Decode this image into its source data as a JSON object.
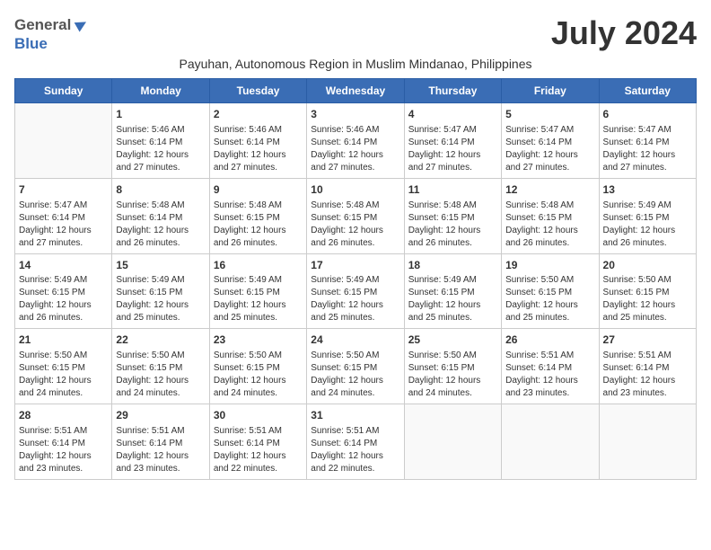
{
  "header": {
    "logo_general": "General",
    "logo_blue": "Blue",
    "month_title": "July 2024",
    "subtitle": "Payuhan, Autonomous Region in Muslim Mindanao, Philippines"
  },
  "days_of_week": [
    "Sunday",
    "Monday",
    "Tuesday",
    "Wednesday",
    "Thursday",
    "Friday",
    "Saturday"
  ],
  "weeks": [
    [
      {
        "day": "",
        "info": ""
      },
      {
        "day": "1",
        "info": "Sunrise: 5:46 AM\nSunset: 6:14 PM\nDaylight: 12 hours\nand 27 minutes."
      },
      {
        "day": "2",
        "info": "Sunrise: 5:46 AM\nSunset: 6:14 PM\nDaylight: 12 hours\nand 27 minutes."
      },
      {
        "day": "3",
        "info": "Sunrise: 5:46 AM\nSunset: 6:14 PM\nDaylight: 12 hours\nand 27 minutes."
      },
      {
        "day": "4",
        "info": "Sunrise: 5:47 AM\nSunset: 6:14 PM\nDaylight: 12 hours\nand 27 minutes."
      },
      {
        "day": "5",
        "info": "Sunrise: 5:47 AM\nSunset: 6:14 PM\nDaylight: 12 hours\nand 27 minutes."
      },
      {
        "day": "6",
        "info": "Sunrise: 5:47 AM\nSunset: 6:14 PM\nDaylight: 12 hours\nand 27 minutes."
      }
    ],
    [
      {
        "day": "7",
        "info": "Sunrise: 5:47 AM\nSunset: 6:14 PM\nDaylight: 12 hours\nand 27 minutes."
      },
      {
        "day": "8",
        "info": "Sunrise: 5:48 AM\nSunset: 6:14 PM\nDaylight: 12 hours\nand 26 minutes."
      },
      {
        "day": "9",
        "info": "Sunrise: 5:48 AM\nSunset: 6:15 PM\nDaylight: 12 hours\nand 26 minutes."
      },
      {
        "day": "10",
        "info": "Sunrise: 5:48 AM\nSunset: 6:15 PM\nDaylight: 12 hours\nand 26 minutes."
      },
      {
        "day": "11",
        "info": "Sunrise: 5:48 AM\nSunset: 6:15 PM\nDaylight: 12 hours\nand 26 minutes."
      },
      {
        "day": "12",
        "info": "Sunrise: 5:48 AM\nSunset: 6:15 PM\nDaylight: 12 hours\nand 26 minutes."
      },
      {
        "day": "13",
        "info": "Sunrise: 5:49 AM\nSunset: 6:15 PM\nDaylight: 12 hours\nand 26 minutes."
      }
    ],
    [
      {
        "day": "14",
        "info": "Sunrise: 5:49 AM\nSunset: 6:15 PM\nDaylight: 12 hours\nand 26 minutes."
      },
      {
        "day": "15",
        "info": "Sunrise: 5:49 AM\nSunset: 6:15 PM\nDaylight: 12 hours\nand 25 minutes."
      },
      {
        "day": "16",
        "info": "Sunrise: 5:49 AM\nSunset: 6:15 PM\nDaylight: 12 hours\nand 25 minutes."
      },
      {
        "day": "17",
        "info": "Sunrise: 5:49 AM\nSunset: 6:15 PM\nDaylight: 12 hours\nand 25 minutes."
      },
      {
        "day": "18",
        "info": "Sunrise: 5:49 AM\nSunset: 6:15 PM\nDaylight: 12 hours\nand 25 minutes."
      },
      {
        "day": "19",
        "info": "Sunrise: 5:50 AM\nSunset: 6:15 PM\nDaylight: 12 hours\nand 25 minutes."
      },
      {
        "day": "20",
        "info": "Sunrise: 5:50 AM\nSunset: 6:15 PM\nDaylight: 12 hours\nand 25 minutes."
      }
    ],
    [
      {
        "day": "21",
        "info": "Sunrise: 5:50 AM\nSunset: 6:15 PM\nDaylight: 12 hours\nand 24 minutes."
      },
      {
        "day": "22",
        "info": "Sunrise: 5:50 AM\nSunset: 6:15 PM\nDaylight: 12 hours\nand 24 minutes."
      },
      {
        "day": "23",
        "info": "Sunrise: 5:50 AM\nSunset: 6:15 PM\nDaylight: 12 hours\nand 24 minutes."
      },
      {
        "day": "24",
        "info": "Sunrise: 5:50 AM\nSunset: 6:15 PM\nDaylight: 12 hours\nand 24 minutes."
      },
      {
        "day": "25",
        "info": "Sunrise: 5:50 AM\nSunset: 6:15 PM\nDaylight: 12 hours\nand 24 minutes."
      },
      {
        "day": "26",
        "info": "Sunrise: 5:51 AM\nSunset: 6:14 PM\nDaylight: 12 hours\nand 23 minutes."
      },
      {
        "day": "27",
        "info": "Sunrise: 5:51 AM\nSunset: 6:14 PM\nDaylight: 12 hours\nand 23 minutes."
      }
    ],
    [
      {
        "day": "28",
        "info": "Sunrise: 5:51 AM\nSunset: 6:14 PM\nDaylight: 12 hours\nand 23 minutes."
      },
      {
        "day": "29",
        "info": "Sunrise: 5:51 AM\nSunset: 6:14 PM\nDaylight: 12 hours\nand 23 minutes."
      },
      {
        "day": "30",
        "info": "Sunrise: 5:51 AM\nSunset: 6:14 PM\nDaylight: 12 hours\nand 22 minutes."
      },
      {
        "day": "31",
        "info": "Sunrise: 5:51 AM\nSunset: 6:14 PM\nDaylight: 12 hours\nand 22 minutes."
      },
      {
        "day": "",
        "info": ""
      },
      {
        "day": "",
        "info": ""
      },
      {
        "day": "",
        "info": ""
      }
    ]
  ]
}
